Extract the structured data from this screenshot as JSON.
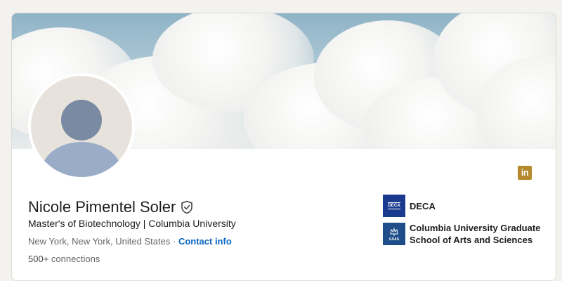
{
  "profile": {
    "name": "Nicole Pimentel Soler",
    "headline": "Master's of Biotechnology | Columbia University",
    "location": "New York, New York, United States",
    "separator": "·",
    "contact_link": "Contact info",
    "connections": "500+",
    "connections_label": "connections"
  },
  "badge": {
    "icon": "linkedin-icon",
    "text": "in",
    "color": "#b5892e"
  },
  "organizations": [
    {
      "name": "DECA",
      "logo_text": "DECA",
      "logo_color": "#1a3a8f"
    },
    {
      "name": "Columbia University Graduate School of Arts and Sciences",
      "logo_text": "GSAS",
      "logo_color": "#1d4e89"
    }
  ],
  "colors": {
    "link": "#0a66c2",
    "text": "#1d1d1d",
    "muted": "#666666"
  }
}
